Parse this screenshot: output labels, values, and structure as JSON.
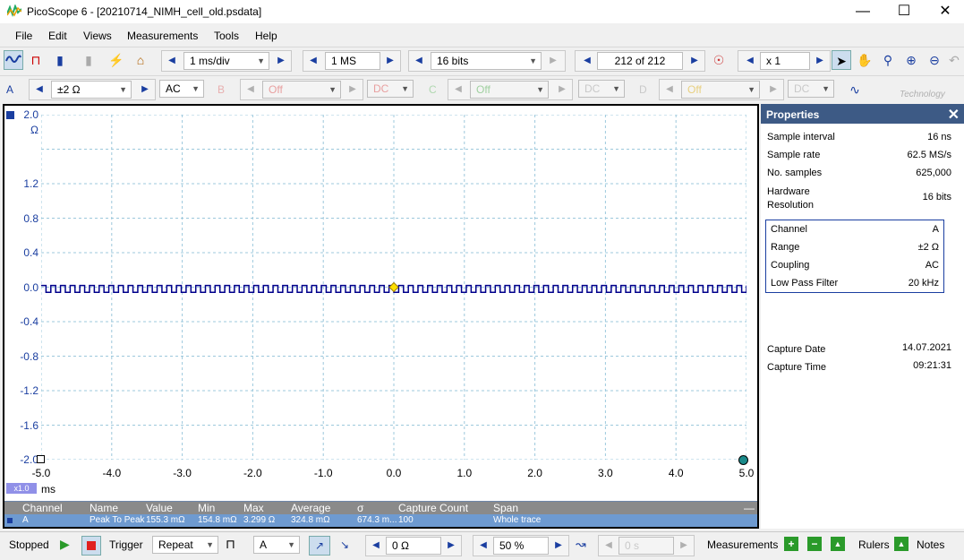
{
  "window": {
    "title": "PicoScope 6 - [20210714_NIMH_cell_old.psdata]"
  },
  "menu": [
    "File",
    "Edit",
    "Views",
    "Measurements",
    "Tools",
    "Help"
  ],
  "toolbar1": {
    "timebase": "1 ms/div",
    "samples": "1 MS",
    "resolution": "16 bits",
    "buffer": "212 of 212",
    "zoom": "x 1"
  },
  "toolbar2": {
    "chA": {
      "label": "A",
      "range": "±2 Ω",
      "coupling": "AC"
    },
    "chB": {
      "label": "B",
      "range": "Off",
      "coupling": "DC"
    },
    "chC": {
      "label": "C",
      "range": "Off",
      "coupling": "DC"
    },
    "chD": {
      "label": "D",
      "range": "Off",
      "coupling": "DC"
    },
    "logo_text": "Technology"
  },
  "scope": {
    "y_unit": "Ω",
    "y_ticks": [
      "2.0",
      "1.2",
      "0.8",
      "0.4",
      "0.0",
      "-0.4",
      "-0.8",
      "-1.2",
      "-1.6",
      "-2.0"
    ],
    "x_ticks": [
      "-5.0",
      "-4.0",
      "-3.0",
      "-2.0",
      "-1.0",
      "0.0",
      "1.0",
      "2.0",
      "3.0",
      "4.0",
      "5.0"
    ],
    "x_unit": "ms",
    "zoom_badge": "x1.0"
  },
  "chart_data": {
    "type": "line",
    "x_range": [
      -5.0,
      5.0
    ],
    "y_range": [
      -2.0,
      2.0
    ],
    "xlabel": "ms",
    "ylabel": "Ω",
    "series": [
      {
        "name": "A",
        "color": "#00008b",
        "shape": "square wave",
        "high": 0.02,
        "low": -0.06,
        "cycles": 73
      }
    ],
    "trigger_marker": {
      "x": 0.0,
      "y": 0.0,
      "color": "#ffe000"
    }
  },
  "measurements": {
    "headers": [
      "Channel",
      "Name",
      "Value",
      "Min",
      "Max",
      "Average",
      "σ",
      "Capture Count",
      "Span"
    ],
    "rows": [
      {
        "channel": "A",
        "name": "Peak To Peak",
        "value": "155.3 mΩ",
        "min": "154.8 mΩ",
        "max": "3.299 Ω",
        "average": "324.8 mΩ",
        "sigma": "674.3 m...",
        "count": "100",
        "span": "Whole trace"
      }
    ]
  },
  "properties": {
    "title": "Properties",
    "general": [
      {
        "k": "Sample interval",
        "v": "16 ns"
      },
      {
        "k": "Sample rate",
        "v": "62.5 MS/s"
      },
      {
        "k": "No. samples",
        "v": "625,000"
      },
      {
        "k": "Hardware Resolution",
        "v": "16 bits"
      }
    ],
    "channel": [
      {
        "k": "Channel",
        "v": "A"
      },
      {
        "k": "Range",
        "v": "±2 Ω"
      },
      {
        "k": "Coupling",
        "v": "AC"
      },
      {
        "k": "Low Pass Filter",
        "v": "20 kHz"
      }
    ],
    "capture": [
      {
        "k": "Capture Date",
        "v": "14.07.2021"
      },
      {
        "k": "Capture Time",
        "v": "09:21:31"
      }
    ]
  },
  "statusbar": {
    "state": "Stopped",
    "trigger_label": "Trigger",
    "trigger_mode": "Repeat",
    "trigger_channel": "A",
    "threshold": "0 Ω",
    "pretrigger": "50 %",
    "delay": "0 s",
    "measurements": "Measurements",
    "rulers": "Rulers",
    "notes": "Notes"
  }
}
